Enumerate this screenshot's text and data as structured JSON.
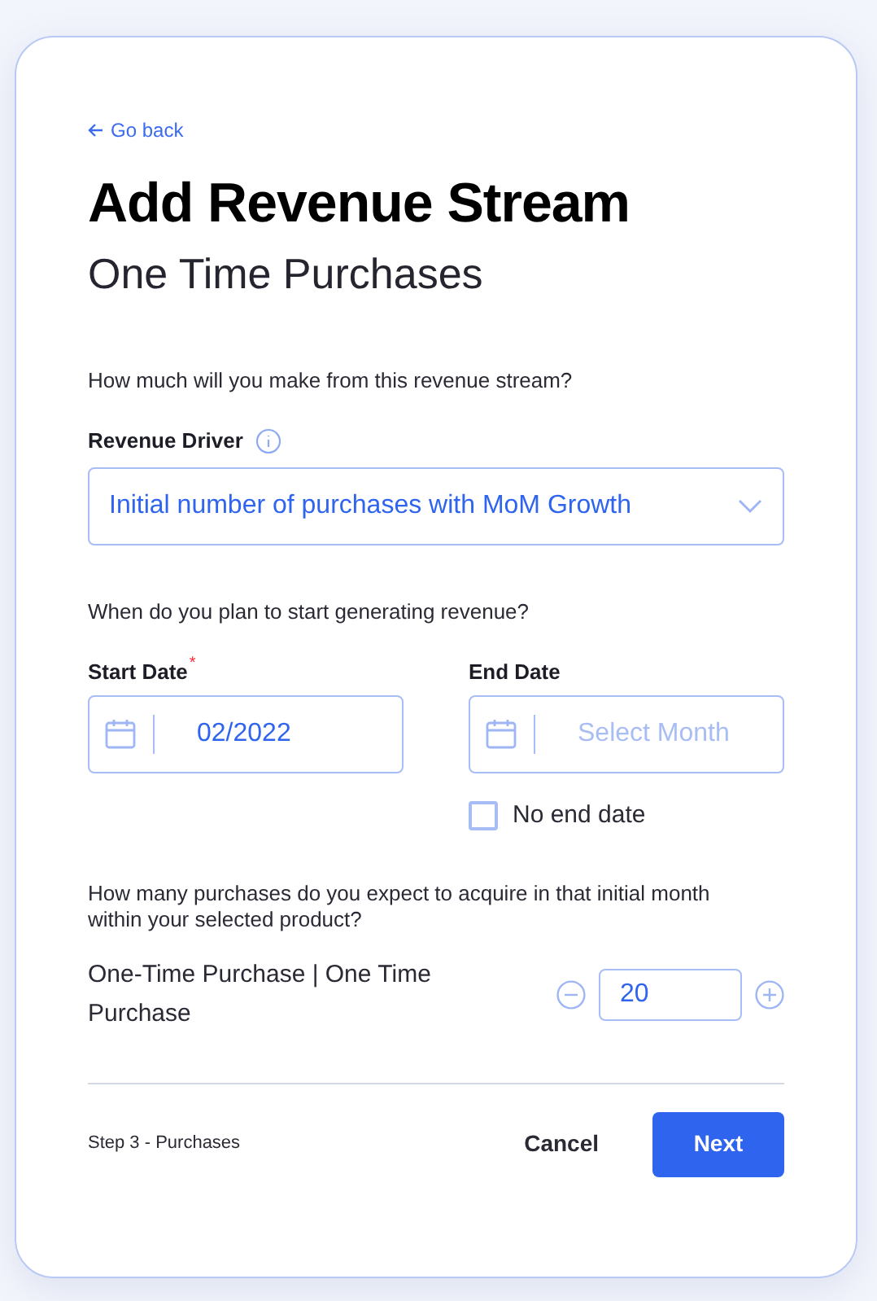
{
  "back_link": "Go back",
  "title": "Add Revenue Stream",
  "subtitle": "One Time Purchases",
  "revenue_question": "How much will you make from this revenue stream?",
  "revenue_driver": {
    "label": "Revenue Driver",
    "value": "Initial number of purchases with MoM Growth"
  },
  "date_question": "When do you plan to start generating revenue?",
  "start_date": {
    "label": "Start Date",
    "required_mark": "*",
    "value": "02/2022"
  },
  "end_date": {
    "label": "End Date",
    "placeholder": "Select Month"
  },
  "no_end_date": {
    "label": "No end date",
    "checked": false
  },
  "purchases_question": "How many purchases do you expect to acquire in that initial month within your selected product?",
  "product": {
    "label": "One-Time Purchase | One Time Purchase",
    "value": "20"
  },
  "footer": {
    "step": "Step 3 - Purchases",
    "cancel": "Cancel",
    "next": "Next"
  }
}
